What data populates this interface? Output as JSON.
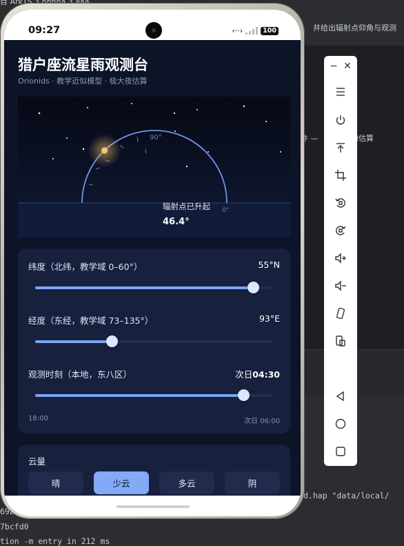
{
  "ide": {
    "top_text": "目 ArkTS 3 nnnna 3 aaa",
    "side_text": "并给出辐射点仰角与观测",
    "side_text2": "件 — 「星数」的估算",
    "console_lines": [
      "d.hap \"data/local/",
      "69b",
      "7bcfd0",
      "tion -m entry in 212 ms"
    ]
  },
  "emulator_toolbar": {
    "minimize": "−",
    "close": "✕",
    "buttons": [
      "menu-icon",
      "power-icon",
      "top-icon",
      "crop-icon",
      "rotate-left-icon",
      "rotate-right-icon",
      "volume-up-icon",
      "volume-down-icon",
      "shake-icon",
      "screenshot-icon",
      "back-icon",
      "home-icon",
      "recent-icon"
    ]
  },
  "status": {
    "time": "09:27",
    "signal": "‹··›",
    "battery": "100"
  },
  "header": {
    "title": "猎户座流星雨观测台",
    "subtitle": "Orionids · 教学近似模型 · 极大夜估算"
  },
  "sky": {
    "arc_top_label": "90°",
    "arc_right_label": "0°",
    "status_label": "辐射点已升起",
    "elevation": "46.4°",
    "elevation_deg": 46.4
  },
  "sliders": [
    {
      "label": "纬度（北纬，教学域 0–60°）",
      "value": "55°N",
      "fraction": 0.917
    },
    {
      "label": "经度（东经，教学域 73–135°）",
      "value": "93°E",
      "fraction": 0.323
    },
    {
      "label": "观测时刻（本地，东八区）",
      "value_prefix": "次日",
      "value": "04:30",
      "fraction": 0.875
    }
  ],
  "time_range": {
    "start": "18:00",
    "end": "次日 06:00"
  },
  "cloud": {
    "label": "云量",
    "options": [
      "晴",
      "少云",
      "多云",
      "阴"
    ],
    "selected": "少云"
  },
  "colors": {
    "accent": "#82aaf6",
    "background": "#0d1428",
    "card": "#17203d",
    "arc": "#6f97e6",
    "radiant": "#f5c96a"
  }
}
